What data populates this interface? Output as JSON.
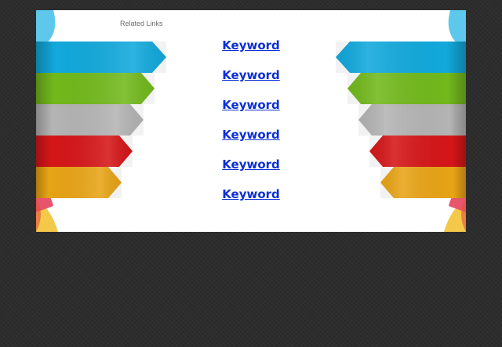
{
  "page": {
    "related_links_label": "Related Links",
    "keywords": [
      {
        "label": "Keyword"
      },
      {
        "label": "Keyword"
      },
      {
        "label": "Keyword"
      },
      {
        "label": "Keyword"
      },
      {
        "label": "Keyword"
      },
      {
        "label": "Keyword"
      }
    ]
  },
  "colors": {
    "page_background": "#2c2c2c",
    "panel_background": "#ffffff",
    "link": "#0b2fd6",
    "ribbon_blue": "#12a9dc",
    "ribbon_green": "#72b91c",
    "ribbon_gray": "#b4b4b4",
    "ribbon_red": "#d51619",
    "ribbon_orange": "#e8a416"
  }
}
